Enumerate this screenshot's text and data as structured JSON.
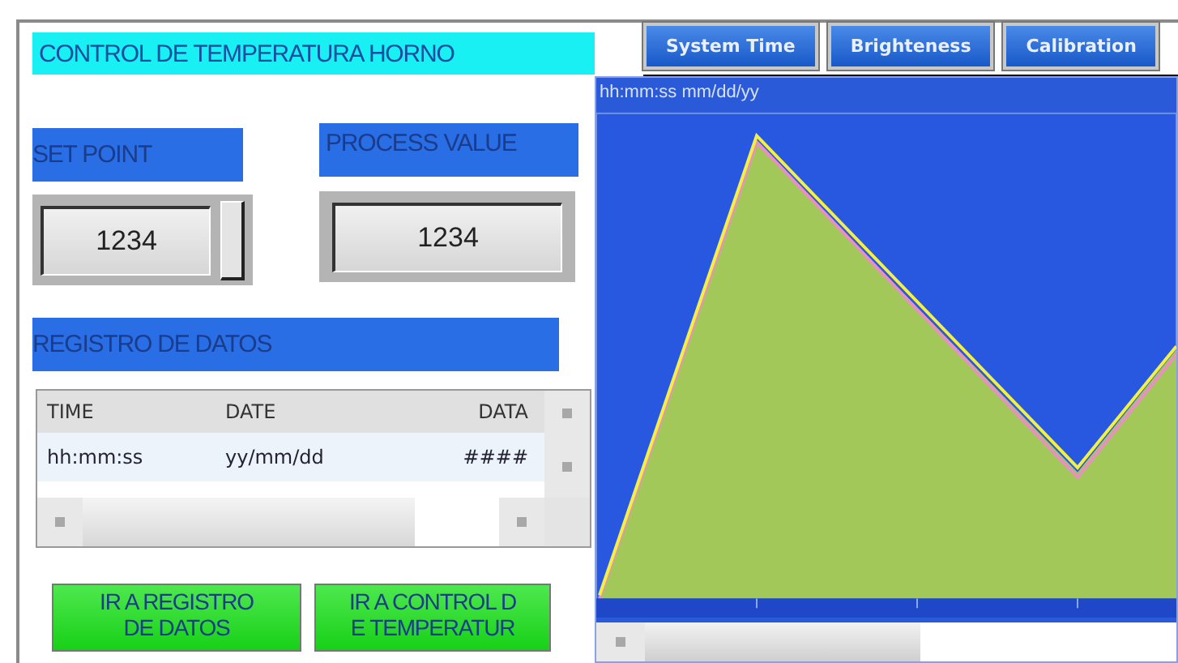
{
  "title": "CONTROL DE TEMPERATURA HORNO",
  "tabs": [
    {
      "label": "System Time",
      "selected": false
    },
    {
      "label": "Brighteness",
      "selected": false
    },
    {
      "label": "Calibration",
      "selected": false
    }
  ],
  "set_point": {
    "label": "SET POINT",
    "value": "1234"
  },
  "process_value": {
    "label": "PROCESS VALUE",
    "value": "1234"
  },
  "log": {
    "title": "REGISTRO DE DATOS",
    "columns": [
      "TIME",
      "DATE",
      "DATA"
    ],
    "rows": [
      [
        "hh:mm:ss",
        "yy/mm/dd",
        "####"
      ]
    ]
  },
  "buttons": [
    {
      "lines": [
        "IR A REGISTRO",
        "DE DATOS"
      ]
    },
    {
      "lines": [
        "IR A CONTROL D",
        "E TEMPERATUR"
      ]
    }
  ],
  "chart": {
    "timestamp": "hh:mm:ss mm/dd/yy"
  }
}
